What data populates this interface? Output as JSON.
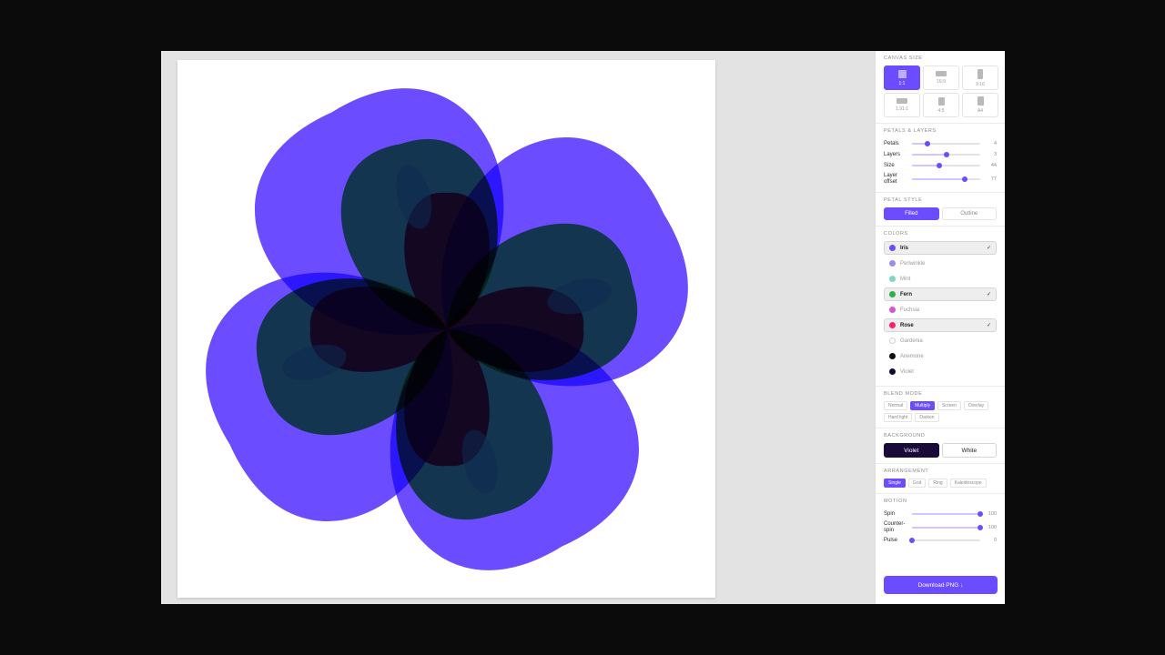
{
  "canvas_size": {
    "title": "CANVAS SIZE",
    "options": [
      {
        "label": "1:1",
        "active": true
      },
      {
        "label": "16:9",
        "active": false
      },
      {
        "label": "9:16",
        "active": false
      },
      {
        "label": "1.91:1",
        "active": false
      },
      {
        "label": "4:5",
        "active": false
      },
      {
        "label": "A4",
        "active": false
      }
    ]
  },
  "petals_layers": {
    "title": "PETALS & LAYERS",
    "sliders": [
      {
        "label": "Petals",
        "value": "4",
        "fraction": 0.22
      },
      {
        "label": "Layers",
        "value": "3",
        "fraction": 0.5
      },
      {
        "label": "Size",
        "value": "44",
        "fraction": 0.4
      },
      {
        "label": "Layer offset",
        "value": "77",
        "fraction": 0.77
      }
    ]
  },
  "petal_style": {
    "title": "PETAL STYLE",
    "options": [
      {
        "label": "Filled",
        "active": true
      },
      {
        "label": "Outline",
        "active": false
      }
    ]
  },
  "colors": {
    "title": "COLORS",
    "items": [
      {
        "name": "Iris",
        "color": "#6b4cff",
        "selected": true
      },
      {
        "name": "Periwinkle",
        "color": "#9b8df0",
        "selected": false
      },
      {
        "name": "Mint",
        "color": "#7fd6c2",
        "selected": false
      },
      {
        "name": "Fern",
        "color": "#2fb04f",
        "selected": true
      },
      {
        "name": "Fuchsia",
        "color": "#d455d8",
        "selected": false
      },
      {
        "name": "Rose",
        "color": "#ff1f6e",
        "selected": true
      },
      {
        "name": "Gardenia",
        "color": "#ffffff",
        "selected": false
      },
      {
        "name": "Anemone",
        "color": "#111111",
        "selected": false
      },
      {
        "name": "Violet",
        "color": "#150a35",
        "selected": false
      }
    ],
    "check_mark": "✓"
  },
  "blend_mode": {
    "title": "BLEND MODE",
    "options": [
      {
        "label": "Normal",
        "active": false
      },
      {
        "label": "Multiply",
        "active": true
      },
      {
        "label": "Screen",
        "active": false
      },
      {
        "label": "Overlay",
        "active": false
      },
      {
        "label": "Hard light",
        "active": false
      },
      {
        "label": "Darken",
        "active": false
      }
    ]
  },
  "background": {
    "title": "BACKGROUND",
    "options": [
      {
        "label": "Violet",
        "active": true
      },
      {
        "label": "White",
        "active": false
      }
    ]
  },
  "arrangement": {
    "title": "ARRANGEMENT",
    "options": [
      {
        "label": "Single",
        "active": true
      },
      {
        "label": "Grid",
        "active": false
      },
      {
        "label": "Ring",
        "active": false
      },
      {
        "label": "Kaleidoscope",
        "active": false
      }
    ]
  },
  "motion": {
    "title": "MOTION",
    "sliders": [
      {
        "label": "Spin",
        "value": "100",
        "fraction": 1.0
      },
      {
        "label": "Counter-spin",
        "value": "100",
        "fraction": 1.0
      },
      {
        "label": "Pulse",
        "value": "0",
        "fraction": 0.0
      }
    ]
  },
  "download_label": "Download PNG ↓",
  "artwork": {
    "petals": 4,
    "layers": 3,
    "layer_colors": [
      "#6b4cff",
      "#2fb04f",
      "#ff1f6e"
    ],
    "overlap_color": "#0d2a52",
    "deep_overlap_color": "#5c0a4a",
    "blend": "multiply"
  }
}
